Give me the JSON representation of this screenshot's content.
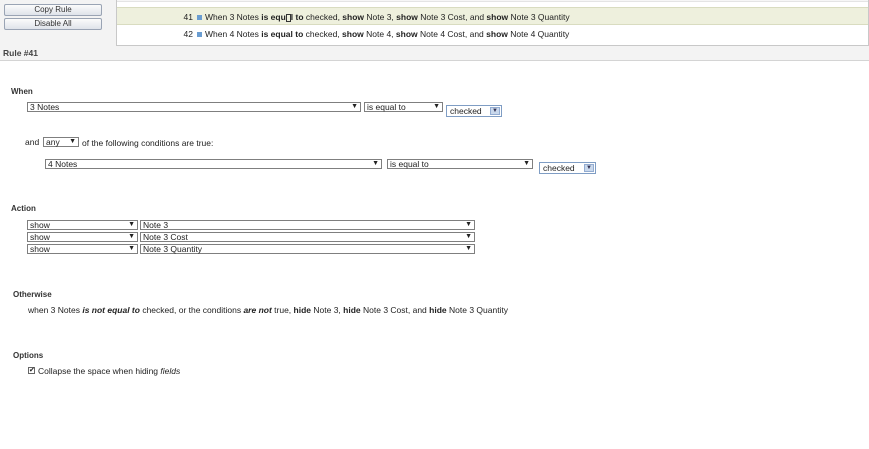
{
  "buttons": {
    "copy_rule": "Copy Rule",
    "disable_all": "Disable All"
  },
  "rules": [
    {
      "number": "41",
      "parts": [
        "When 3 Notes ",
        "is equ",
        "l to",
        " checked, ",
        "show",
        " Note 3, ",
        "show",
        " Note 3 Cost, and ",
        "show",
        " Note 3 Quantity"
      ]
    },
    {
      "number": "42",
      "parts": [
        "When 4 Notes ",
        "is equal to",
        " checked, ",
        "show",
        " Note 4, ",
        "show",
        " Note 4 Cost, and ",
        "show",
        " Note 4 Quantity"
      ]
    }
  ],
  "rule_label": "Rule #41",
  "when": {
    "heading": "When",
    "field": "3 Notes",
    "operator": "is equal to",
    "value": "checked",
    "and_prefix": "and",
    "quantifier": "any",
    "and_suffix": "of the following conditions are true:",
    "condition": {
      "field": "4 Notes",
      "operator": "is equal to",
      "value": "checked"
    }
  },
  "action": {
    "heading": "Action",
    "rows": [
      {
        "verb": "show",
        "target": "Note 3"
      },
      {
        "verb": "show",
        "target": "Note 3 Cost"
      },
      {
        "verb": "show",
        "target": "Note 3 Quantity"
      }
    ]
  },
  "otherwise": {
    "heading": "Otherwise",
    "parts": [
      "when 3 Notes ",
      "is not equal to",
      " checked, or the conditions ",
      "are not",
      " true, ",
      "hide",
      " Note 3, ",
      "hide",
      " Note 3 Cost, and ",
      "hide",
      " Note 3 Quantity"
    ]
  },
  "options": {
    "heading": "Options",
    "collapse_checked": true,
    "collapse_prefix": "Collapse the space when hiding ",
    "collapse_italic": "fields"
  },
  "icons": {
    "dropdown": "▼",
    "checkbox_checked": "✔"
  }
}
